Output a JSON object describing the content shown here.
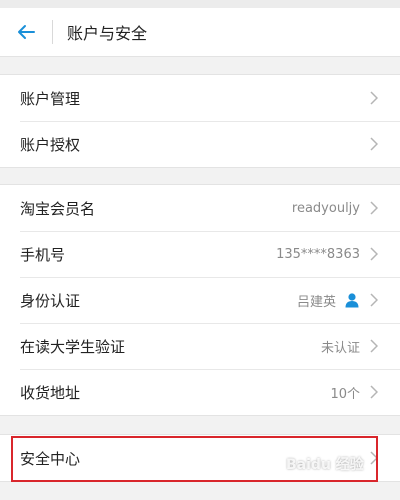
{
  "header": {
    "title": "账户与安全"
  },
  "group1": [
    {
      "label": "账户管理"
    },
    {
      "label": "账户授权"
    }
  ],
  "group2": [
    {
      "label": "淘宝会员名",
      "value": "readyouljy"
    },
    {
      "label": "手机号",
      "value": "135****8363"
    },
    {
      "label": "身份认证",
      "value": "吕建英"
    },
    {
      "label": "在读大学生验证",
      "value": "未认证"
    },
    {
      "label": "收货地址",
      "value": "10个"
    }
  ],
  "group3": [
    {
      "label": "安全中心"
    }
  ],
  "watermark": {
    "text": "Baidu 经验"
  },
  "colors": {
    "accent": "#1a8fd8",
    "highlight": "#d9262c",
    "verified": "#1a8fd8"
  },
  "icons": {
    "back": "back-arrow-icon",
    "chevron": "chevron-right-icon",
    "identity": "person-verified-icon"
  }
}
